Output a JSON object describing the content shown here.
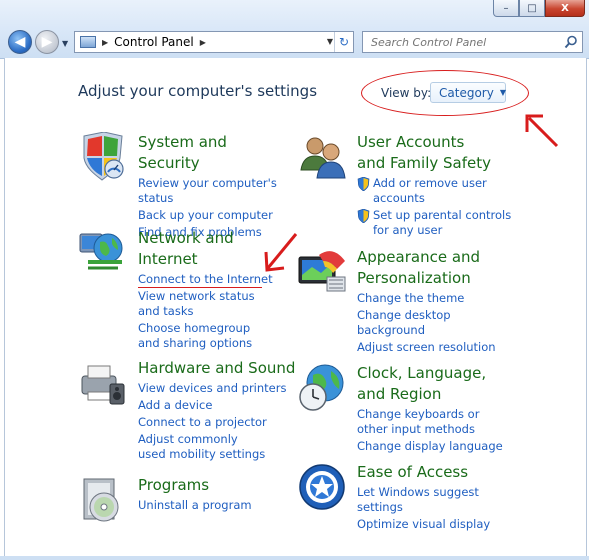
{
  "window": {
    "minimize_symbol": "–",
    "maximize_symbol": "□",
    "close_symbol": "X"
  },
  "nav": {
    "back_icon": "back-arrow-icon",
    "forward_icon": "forward-arrow-icon"
  },
  "address": {
    "breadcrumb": "Control Panel"
  },
  "search": {
    "placeholder": "Search Control Panel"
  },
  "main": {
    "title": "Adjust your computer's settings",
    "view_by_label": "View by:",
    "view_by_value": "Category"
  },
  "categories": {
    "system_security": {
      "title": "System and Security",
      "links": [
        "Review your computer's status",
        "Back up your computer",
        "Find and fix problems"
      ]
    },
    "network": {
      "title": "Network and Internet",
      "links": [
        "Connect to the Internet",
        "View network status and tasks",
        "Choose homegroup and sharing options"
      ]
    },
    "hardware": {
      "title": "Hardware and Sound",
      "links": [
        "View devices and printers",
        "Add a device",
        "Connect to a projector",
        "Adjust commonly used mobility settings"
      ]
    },
    "programs": {
      "title": "Programs",
      "links": [
        "Uninstall a program"
      ]
    },
    "user_accounts": {
      "title": "User Accounts and Family Safety",
      "links": [
        "Add or remove user accounts",
        "Set up parental controls for any user"
      ]
    },
    "appearance": {
      "title": "Appearance and Personalization",
      "links": [
        "Change the theme",
        "Change desktop background",
        "Adjust screen resolution"
      ]
    },
    "clock": {
      "title": "Clock, Language, and Region",
      "links": [
        "Change keyboards or other input methods",
        "Change display language"
      ]
    },
    "ease": {
      "title": "Ease of Access",
      "links": [
        "Let Windows suggest settings",
        "Optimize visual display"
      ]
    }
  },
  "colors": {
    "category_title": "#1a6b1a",
    "link": "#1f5ec0",
    "annotation": "#d81c1c"
  }
}
